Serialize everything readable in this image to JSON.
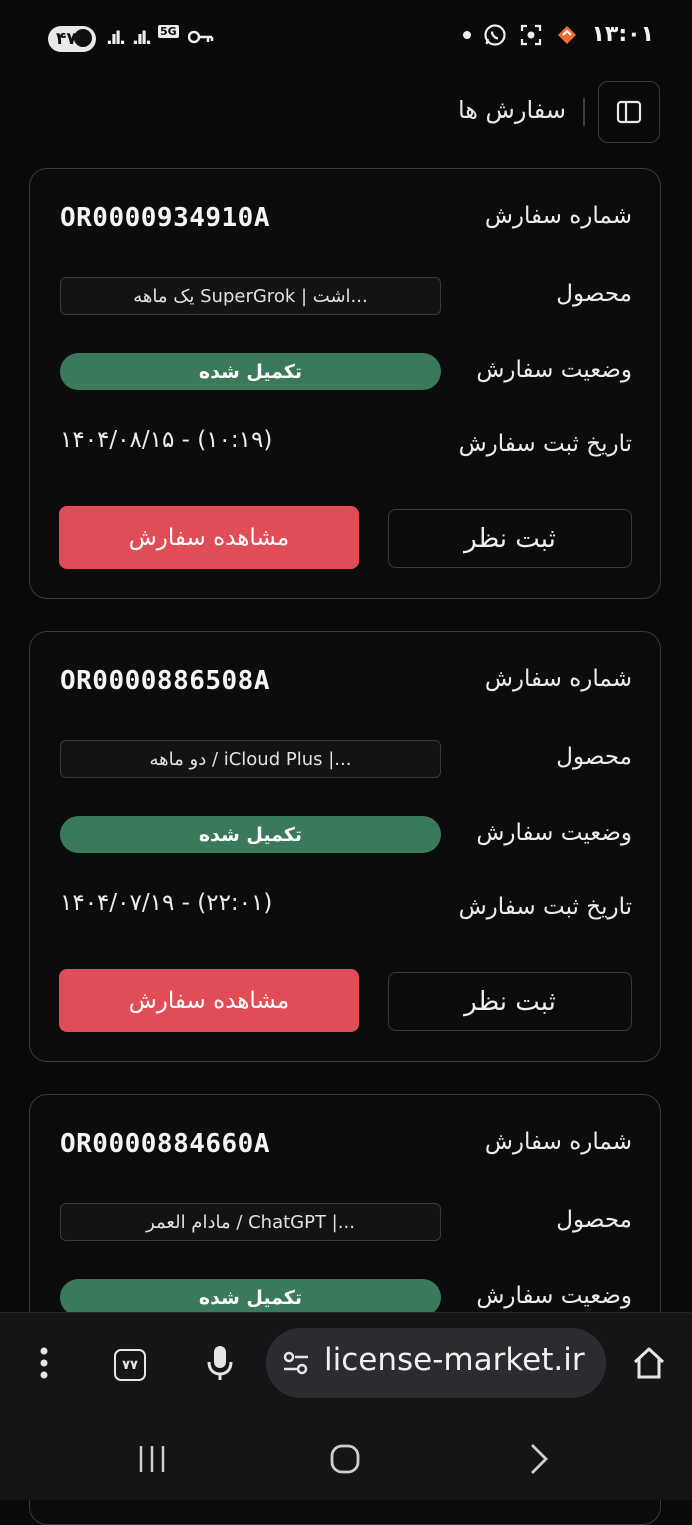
{
  "status_bar": {
    "time": "۱۳:۰۱",
    "battery": "۴۷",
    "network": "5G"
  },
  "header": {
    "title": "سفارش ها"
  },
  "labels": {
    "order_number": "شماره سفارش",
    "product": "محصول",
    "order_status": "وضعیت سفارش",
    "order_date": "تاریخ ثبت سفارش",
    "view_order": "مشاهده سفارش",
    "submit_review": "ثبت نظر"
  },
  "orders": [
    {
      "number": "OR0000934910A",
      "product": "یک ماهه SuperGrok | اشت...",
      "status": "تکمیل شده",
      "date": "۱۴۰۴/۰۸/۱۵ - (۱۰:۱۹)"
    },
    {
      "number": "OR0000886508A",
      "product": "دو ماهه / iCloud Plus |...",
      "status": "تکمیل شده",
      "date": "۱۴۰۴/۰۷/۱۹ - (۲۲:۰۱)"
    },
    {
      "number": "OR0000884660A",
      "product": "مادام العمر / ChatGPT |...",
      "status": "تکمیل شده",
      "date": ""
    }
  ],
  "browser": {
    "url": "license-market.ir",
    "tab_count": "۷۷"
  },
  "colors": {
    "background": "#0a0a0a",
    "status_complete": "#3a7a5a",
    "primary_button": "#e04d56",
    "border": "#3a3a3a"
  }
}
